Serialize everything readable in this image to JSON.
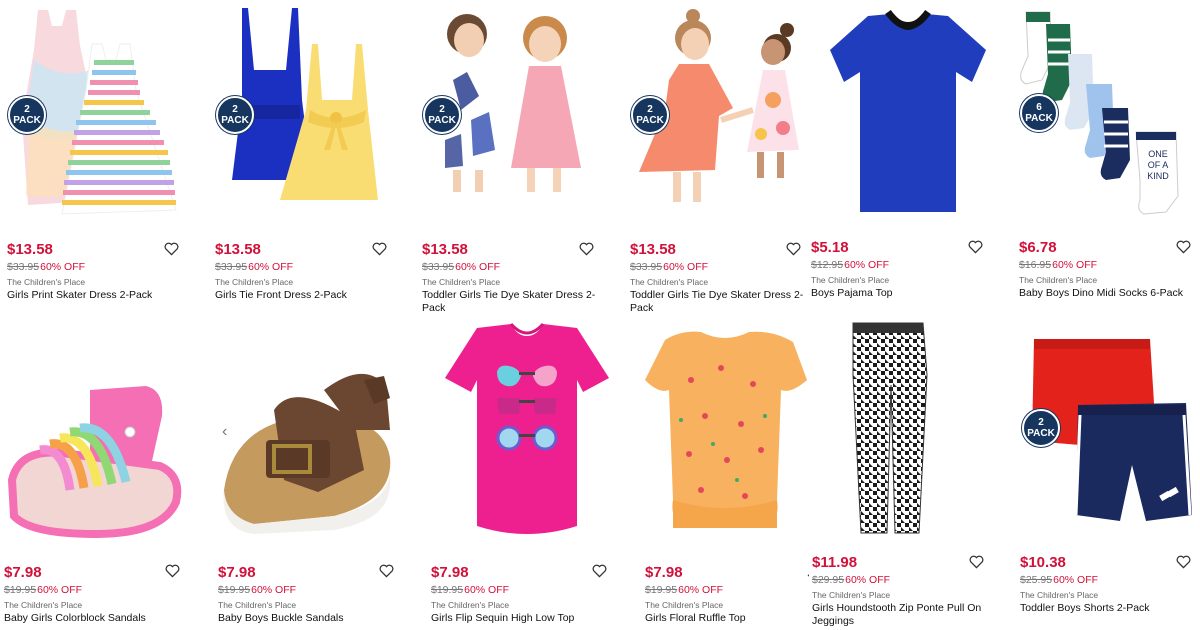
{
  "products": [
    {
      "price": "$13.58",
      "original_price": "$33.95",
      "discount": "60% OFF",
      "brand": "The Children's Place",
      "name": "Girls Print Skater Dress 2-Pack",
      "badge": [
        "2",
        "PACK"
      ],
      "image_icon": "dress-2pack-image"
    },
    {
      "price": "$13.58",
      "original_price": "$33.95",
      "discount": "60% OFF",
      "brand": "The Children's Place",
      "name": "Girls Tie Front Dress 2-Pack",
      "badge": [
        "2",
        "PACK"
      ],
      "image_icon": "dress-2pack-image"
    },
    {
      "price": "$13.58",
      "original_price": "$33.95",
      "discount": "60% OFF",
      "brand": "The Children's Place",
      "name": "Toddler Girls Tie Dye Skater Dress 2-Pack",
      "badge": [
        "2",
        "PACK"
      ],
      "image_icon": "kids-photo-image"
    },
    {
      "price": "$13.58",
      "original_price": "$33.95",
      "discount": "60% OFF",
      "brand": "The Children's Place",
      "name": "Toddler Girls Tie Dye Skater Dress 2-Pack",
      "badge": [
        "2",
        "PACK"
      ],
      "image_icon": "kids-photo-image"
    },
    {
      "price": "$5.18",
      "original_price": "$12.95",
      "discount": "60% OFF",
      "brand": "The Children's Place",
      "name": "Boys Pajama Top",
      "badge": null,
      "image_icon": "tshirt-image"
    },
    {
      "price": "$6.78",
      "original_price": "$16.95",
      "discount": "60% OFF",
      "brand": "The Children's Place",
      "name": "Baby Boys Dino Midi Socks 6-Pack",
      "badge": [
        "6",
        "PACK"
      ],
      "image_icon": "socks-image",
      "sock_text": [
        "ONE",
        "OF A",
        "KIND"
      ]
    },
    {
      "price": "$7.98",
      "original_price": "$19.95",
      "discount": "60% OFF",
      "brand": "The Children's Place",
      "name": "Baby Girls Colorblock Sandals",
      "badge": null,
      "image_icon": "sandal-image"
    },
    {
      "price": "$7.98",
      "original_price": "$19.95",
      "discount": "60% OFF",
      "brand": "The Children's Place",
      "name": "Baby Boys Buckle Sandals",
      "badge": null,
      "image_icon": "sandal-image"
    },
    {
      "price": "$7.98",
      "original_price": "$19.95",
      "discount": "60% OFF",
      "brand": "The Children's Place",
      "name": "Girls Flip Sequin High Low Top",
      "badge": null,
      "image_icon": "tshirt-image"
    },
    {
      "price": "$7.98",
      "original_price": "$19.95",
      "discount": "60% OFF",
      "brand": "The Children's Place",
      "name": "Girls Floral Ruffle Top",
      "badge": null,
      "image_icon": "top-image"
    },
    {
      "price": "$11.98",
      "original_price": "$29.95",
      "discount": "60% OFF",
      "brand": "The Children's Place",
      "name": "Girls Houndstooth Zip Ponte Pull On Jeggings",
      "badge": null,
      "image_icon": "pants-image"
    },
    {
      "price": "$10.38",
      "original_price": "$25.95",
      "discount": "60% OFF",
      "brand": "The Children's Place",
      "name": "Toddler Boys Shorts 2-Pack",
      "badge": [
        "2",
        "PACK"
      ],
      "image_icon": "shorts-image"
    }
  ],
  "icons": {
    "wishlist": "heart-outline-icon",
    "carousel_prev": "chevron-left-icon"
  },
  "colors": {
    "price": "#d1113a",
    "badge": "#17365f"
  }
}
